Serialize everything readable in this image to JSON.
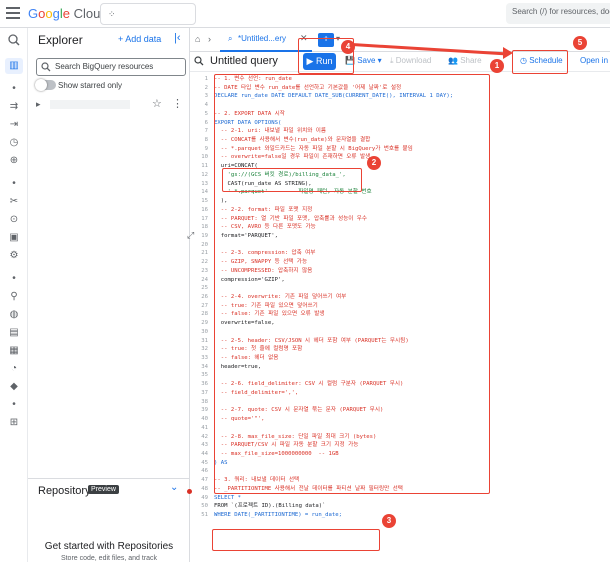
{
  "app": {
    "brand_google": [
      "G",
      "o",
      "o",
      "g",
      "l",
      "e"
    ],
    "brand_cloud": "Cloud",
    "search_placeholder": "Search (/) for resources, doc"
  },
  "explorer": {
    "title": "Explorer",
    "add_data": "+ Add data",
    "search_placeholder": "Search BigQuery resources",
    "show_starred": "Show starred only",
    "repository_title": "Repository",
    "repository_badge": "Preview",
    "repo_heading": "Get started with Repositories",
    "repo_sub": "Store code, edit files, and track"
  },
  "tabs": {
    "active_label": "*Untitled...ery"
  },
  "toolbar": {
    "query_title": "Untitled query",
    "run_label": "Run",
    "save_label": "Save",
    "download_label": "Download",
    "share_label": "Share",
    "schedule_label": "Schedule",
    "open_in_label": "Open in"
  },
  "code_lines": [
    {
      "n": "1",
      "t": "-- 1. 변수 선언: run_date",
      "c": "c-cm"
    },
    {
      "n": "2",
      "t": "-- DATE 타입 변수 run_date를 선언하고 기본값을 '어제 날짜'로 설정",
      "c": "c-cm"
    },
    {
      "n": "3",
      "t": "DECLARE run_date DATE DEFAULT DATE_SUB(CURRENT_DATE(), INTERVAL 1 DAY);",
      "c": "c-kw"
    },
    {
      "n": "4",
      "t": "",
      "c": "c-txt"
    },
    {
      "n": "5",
      "t": "-- 2. EXPORT DATA 시작",
      "c": "c-cm"
    },
    {
      "n": "6",
      "t": "EXPORT DATA OPTIONS(",
      "c": "c-kw"
    },
    {
      "n": "7",
      "t": "  -- 2-1. uri: 내보낼 파일 위치와 이름",
      "c": "c-cm"
    },
    {
      "n": "8",
      "t": "  -- CONCAT를 사용해서 변수(run_date)와 문자열을 결합",
      "c": "c-cm"
    },
    {
      "n": "9",
      "t": "  -- *.parquet 와일드카드는 자동 파일 분할 시 BigQuery가 번호를 붙임",
      "c": "c-cm"
    },
    {
      "n": "10",
      "t": "  -- overwrite=false일 경우 파일이 존재하면 오류 발생",
      "c": "c-cm"
    },
    {
      "n": "11",
      "t": "  uri=CONCAT(",
      "c": "c-txt"
    },
    {
      "n": "12",
      "t": "    'gs://(GCS 버킷 경로)/billing_data_',",
      "c": "c-str"
    },
    {
      "n": "13",
      "t": "    CAST(run_date AS STRING),",
      "c": "c-txt"
    },
    {
      "n": "14",
      "t": "    '-*.parquet'      -- 파일명 패턴, 자동 분할 번호",
      "c": "c-str"
    },
    {
      "n": "15",
      "t": "  ),",
      "c": "c-txt"
    },
    {
      "n": "16",
      "t": "  -- 2-2. format: 파일 포맷 지정",
      "c": "c-cm"
    },
    {
      "n": "17",
      "t": "  -- PARQUET: 열 기반 파일 포맷, 압축률과 성능이 우수",
      "c": "c-cm"
    },
    {
      "n": "18",
      "t": "  -- CSV, AVRO 등 다른 포맷도 가능",
      "c": "c-cm"
    },
    {
      "n": "19",
      "t": "  format='PARQUET',",
      "c": "c-txt"
    },
    {
      "n": "20",
      "t": "",
      "c": "c-txt"
    },
    {
      "n": "21",
      "t": "  -- 2-3. compression: 압축 여부",
      "c": "c-cm"
    },
    {
      "n": "22",
      "t": "  -- GZIP, SNAPPY 등 선택 가능",
      "c": "c-cm"
    },
    {
      "n": "23",
      "t": "  -- UNCOMPRESSED: 압축하지 않음",
      "c": "c-cm"
    },
    {
      "n": "24",
      "t": "  compression='GZIP',",
      "c": "c-txt"
    },
    {
      "n": "25",
      "t": "",
      "c": "c-txt"
    },
    {
      "n": "26",
      "t": "  -- 2-4. overwrite: 기존 파일 덮어쓰기 여부",
      "c": "c-cm"
    },
    {
      "n": "27",
      "t": "  -- true: 기존 파일 있으면 덮어쓰기",
      "c": "c-cm"
    },
    {
      "n": "28",
      "t": "  -- false: 기존 파일 있으면 오류 발생",
      "c": "c-cm"
    },
    {
      "n": "29",
      "t": "  overwrite=false,",
      "c": "c-txt"
    },
    {
      "n": "30",
      "t": "",
      "c": "c-txt"
    },
    {
      "n": "31",
      "t": "  -- 2-5. header: CSV/JSON 시 헤더 포함 여부 (PARQUET는 무시됨)",
      "c": "c-cm"
    },
    {
      "n": "32",
      "t": "  -- true: 첫 줄에 컬럼명 포함",
      "c": "c-cm"
    },
    {
      "n": "33",
      "t": "  -- false: 헤더 없음",
      "c": "c-cm"
    },
    {
      "n": "34",
      "t": "  header=true,",
      "c": "c-txt"
    },
    {
      "n": "35",
      "t": "",
      "c": "c-txt"
    },
    {
      "n": "36",
      "t": "  -- 2-6. field_delimiter: CSV 시 컬럼 구분자 (PARQUET 무시)",
      "c": "c-cm"
    },
    {
      "n": "37",
      "t": "  -- field_delimiter=',',",
      "c": "c-cm"
    },
    {
      "n": "38",
      "t": "",
      "c": "c-txt"
    },
    {
      "n": "39",
      "t": "  -- 2-7. quote: CSV 시 문자열 묶는 문자 (PARQUET 무시)",
      "c": "c-cm"
    },
    {
      "n": "40",
      "t": "  -- quote='\"',",
      "c": "c-cm"
    },
    {
      "n": "41",
      "t": "",
      "c": "c-txt"
    },
    {
      "n": "42",
      "t": "  -- 2-8. max_file_size: 단일 파일 최대 크기 (bytes)",
      "c": "c-cm"
    },
    {
      "n": "43",
      "t": "  -- PARQUET/CSV 시 파일 자동 분할 크기 지정 가능",
      "c": "c-cm"
    },
    {
      "n": "44",
      "t": "  -- max_file_size=1000000000  -- 1GB",
      "c": "c-cm"
    },
    {
      "n": "45",
      "t": ") AS",
      "c": "c-kw"
    },
    {
      "n": "46",
      "t": "",
      "c": "c-txt"
    },
    {
      "n": "47",
      "t": "-- 3. 쿼리: 내보낼 데이터 선택",
      "c": "c-cm"
    },
    {
      "n": "48",
      "t": "-- _PARTITIONTIME 사용해서 전날 데이터를 파티션 날짜 필터링만 선택",
      "c": "c-cm"
    },
    {
      "n": "49",
      "t": "SELECT *",
      "c": "c-kw"
    },
    {
      "n": "50",
      "t": "FROM `(프로젝트 ID).(Billing data)`",
      "c": "c-txt"
    },
    {
      "n": "51",
      "t": "WHERE DATE(_PARTITIONTIME) = run_date;",
      "c": "c-kw"
    }
  ],
  "annotations": {
    "badge1": "1",
    "badge2": "2",
    "badge3": "3",
    "badge4": "4",
    "badge5": "5",
    "color": "#ea4335"
  },
  "colors": {
    "accent": "#1a73e8",
    "comment": "#d93025",
    "keyword": "#1967d2",
    "string": "#188038"
  }
}
